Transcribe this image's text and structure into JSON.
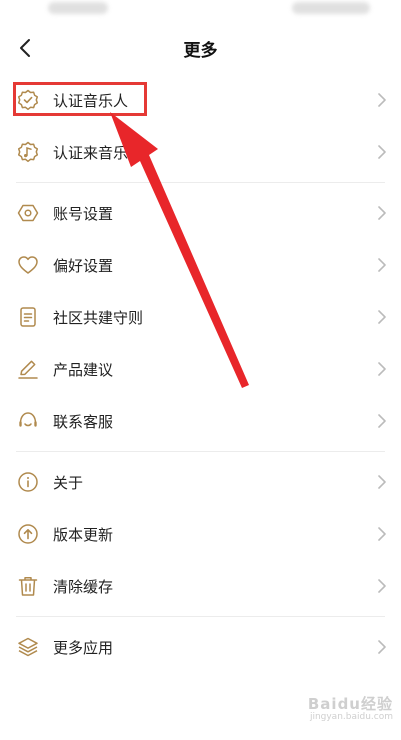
{
  "header": {
    "title": "更多"
  },
  "menu": {
    "group1": [
      {
        "label": "认证音乐人",
        "icon": "verified-badge-icon"
      },
      {
        "label": "认证来音乐师",
        "icon": "music-badge-icon"
      }
    ],
    "group2": [
      {
        "label": "账号设置",
        "icon": "hexagon-settings-icon"
      },
      {
        "label": "偏好设置",
        "icon": "heart-icon"
      },
      {
        "label": "社区共建守则",
        "icon": "document-icon"
      },
      {
        "label": "产品建议",
        "icon": "pencil-icon"
      },
      {
        "label": "联系客服",
        "icon": "headset-icon"
      }
    ],
    "group3": [
      {
        "label": "关于",
        "icon": "info-icon"
      },
      {
        "label": "版本更新",
        "icon": "upload-arrow-icon"
      },
      {
        "label": "清除缓存",
        "icon": "trash-icon"
      }
    ],
    "group4": [
      {
        "label": "更多应用",
        "icon": "layers-icon"
      }
    ]
  },
  "watermark": {
    "text": "Baidu经验",
    "sub": "jingyan.baidu.com"
  },
  "colors": {
    "icon": "#b08a4e",
    "highlight": "#e53935",
    "arrow": "#e8262a"
  }
}
